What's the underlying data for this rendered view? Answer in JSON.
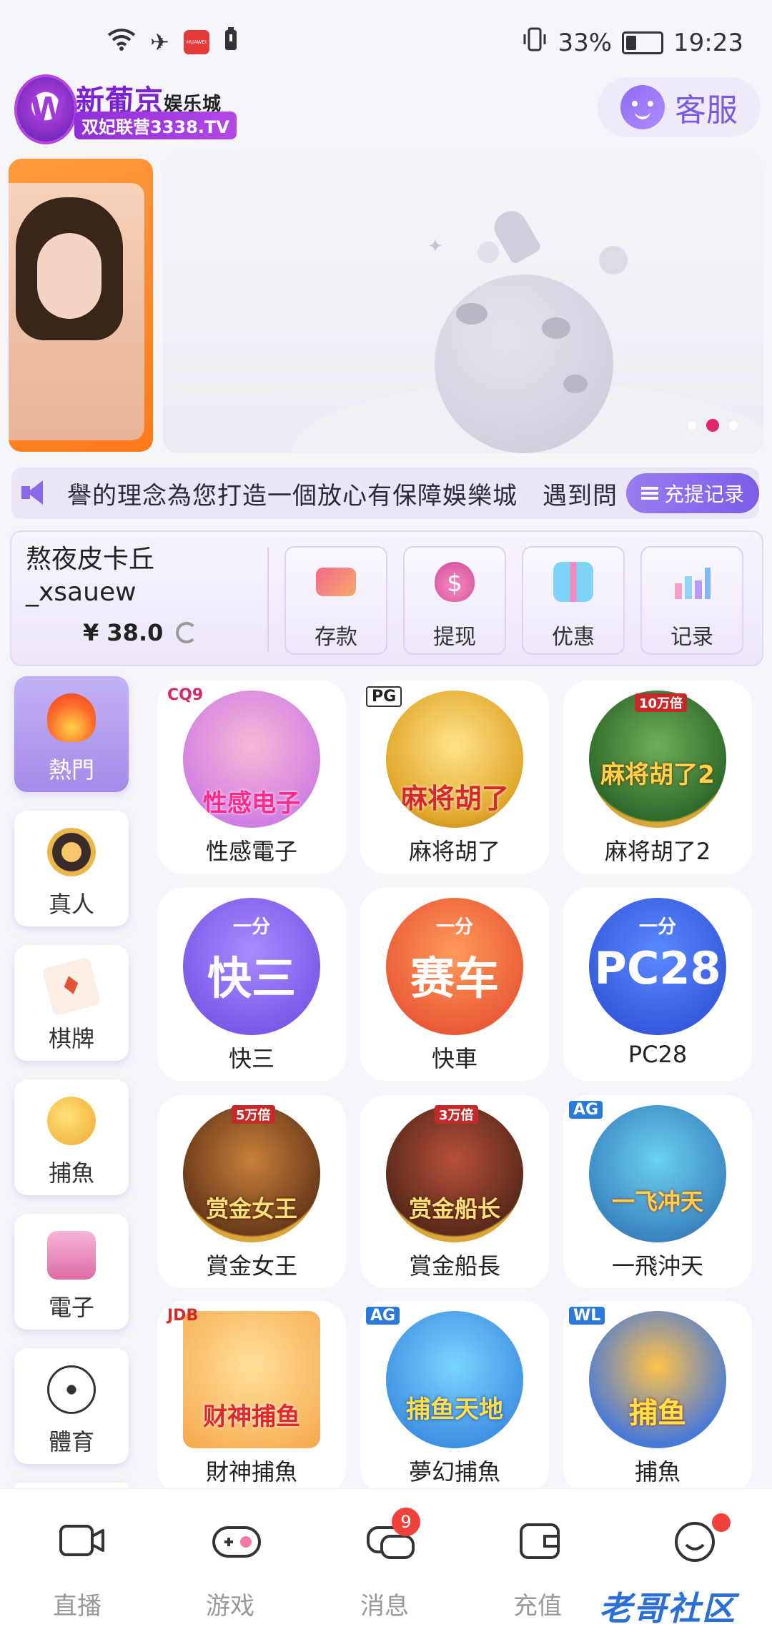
{
  "status_bar": {
    "battery_percent": "33%",
    "time": "19:23",
    "icons": [
      "wifi-icon",
      "airplane-icon",
      "huawei-app-icon",
      "battery-small-icon",
      "vibrate-icon",
      "battery-charging-icon"
    ]
  },
  "header": {
    "brand_name": "新葡京",
    "brand_suffix": "娱乐城",
    "brand_sub": "双妃联营3338.TV",
    "service_label": "客服"
  },
  "banner": {
    "slide_count": 3,
    "active_slide": 2
  },
  "notice": {
    "text": "譽的理念為您打造一個放心有保障娛樂城　遇到問",
    "record_button": "充提记录"
  },
  "account": {
    "username_line1": "熬夜皮卡丘",
    "username_line2": "_xsauew",
    "balance": "¥ 38.0",
    "actions": [
      {
        "label": "存款",
        "icon": "card-icon"
      },
      {
        "label": "提现",
        "icon": "money-bag-icon"
      },
      {
        "label": "优惠",
        "icon": "gift-icon"
      },
      {
        "label": "记录",
        "icon": "bar-chart-icon"
      }
    ]
  },
  "sidebar": {
    "items": [
      {
        "label": "熱門",
        "icon": "flame-icon",
        "active": true
      },
      {
        "label": "真人",
        "icon": "poker-chip-icon"
      },
      {
        "label": "棋牌",
        "icon": "playing-card-icon"
      },
      {
        "label": "捕魚",
        "icon": "shark-icon"
      },
      {
        "label": "電子",
        "icon": "slot-machine-icon"
      },
      {
        "label": "體育",
        "icon": "soccer-ball-icon"
      }
    ]
  },
  "games": [
    {
      "name": "性感電子",
      "tag": "CQ9",
      "art_text": "性感电子"
    },
    {
      "name": "麻将胡了",
      "tag": "PG",
      "art_text": "麻将胡了"
    },
    {
      "name": "麻将胡了2",
      "tag": "10万倍",
      "art_text": "麻将胡了2"
    },
    {
      "name": "快三",
      "tag": "一分",
      "art_text": "快三"
    },
    {
      "name": "快車",
      "tag": "一分",
      "art_text": "赛车"
    },
    {
      "name": "PC28",
      "tag": "一分",
      "art_text": "PC28"
    },
    {
      "name": "賞金女王",
      "tag": "5万倍",
      "art_text": "赏金女王"
    },
    {
      "name": "賞金船長",
      "tag": "3万倍",
      "art_text": "赏金船长"
    },
    {
      "name": "一飛沖天",
      "tag": "AG",
      "art_text": "一飞冲天"
    },
    {
      "name": "財神捕魚",
      "tag": "JDB",
      "art_text": "财神捕鱼"
    },
    {
      "name": "夢幻捕魚",
      "tag": "AG",
      "art_text": "捕鱼天地"
    },
    {
      "name": "捕魚",
      "tag": "WL",
      "art_text": "捕鱼"
    }
  ],
  "bottom_nav": {
    "items": [
      {
        "label": "直播",
        "icon": "camera-icon"
      },
      {
        "label": "游戏",
        "icon": "gamepad-icon"
      },
      {
        "label": "消息",
        "icon": "chat-icon",
        "badge": "9"
      },
      {
        "label": "充值",
        "icon": "wallet-icon"
      },
      {
        "label": "",
        "icon": "smile-icon",
        "dot": true
      }
    ]
  },
  "watermark": "老哥社区",
  "colors": {
    "accent_purple": "#8a6ae6",
    "active_dot": "#e2266b",
    "badge_red": "#f0413a"
  }
}
